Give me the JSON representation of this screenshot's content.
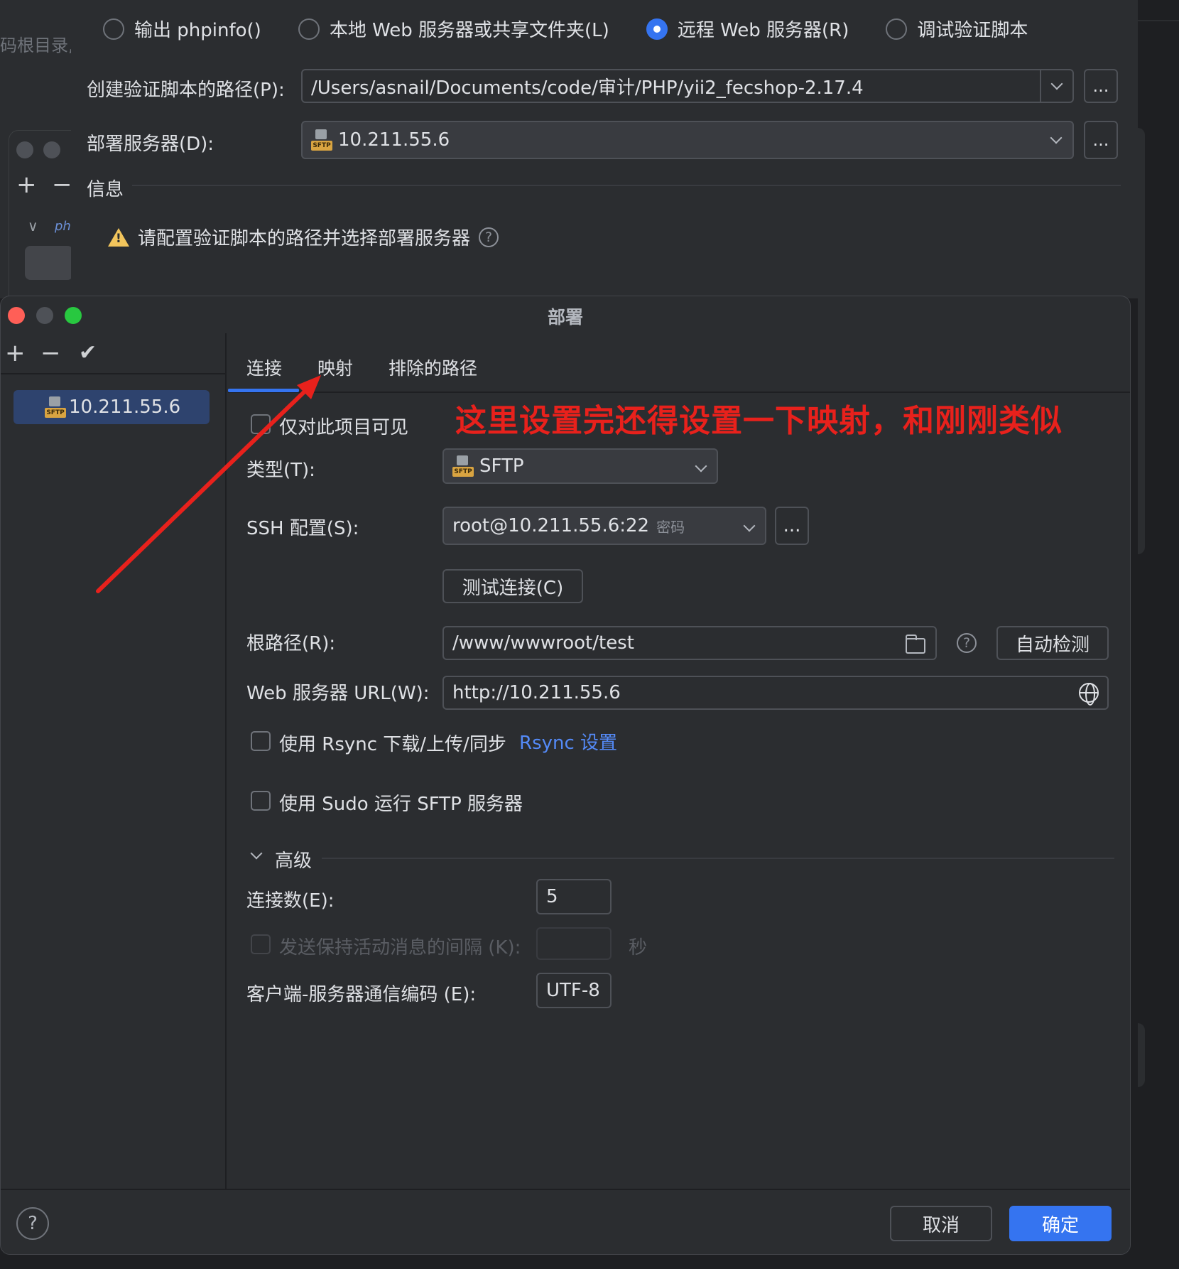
{
  "background_window": {
    "left_text": "码根目录,",
    "radio_options": [
      {
        "label": "输出 phpinfo()",
        "selected": false
      },
      {
        "label": "本地 Web 服务器或共享文件夹(L)",
        "selected": false
      },
      {
        "label": "远程 Web 服务器(R)",
        "selected": true
      },
      {
        "label": "调试验证脚本",
        "selected": false
      }
    ],
    "script_path_label": "创建验证脚本的路径(P):",
    "script_path_value": "/Users/asnail/Documents/code/审计/PHP/yii2_fecshop-2.17.4",
    "deploy_server_label": "部署服务器(D):",
    "deploy_server_value": "10.211.55.6",
    "info_heading": "信息",
    "warning_text": "请配置验证脚本的路径并选择部署服务器",
    "more_button": "...",
    "mini_php": "ph"
  },
  "dialog": {
    "title": "部署",
    "server_list": [
      "10.211.55.6"
    ],
    "tabs": [
      "连接",
      "映射",
      "排除的路径"
    ],
    "active_tab": "连接",
    "visible_only_label": "仅对此项目可见",
    "type_label": "类型(T):",
    "type_value": "SFTP",
    "ssh_label": "SSH 配置(S):",
    "ssh_value": "root@10.211.55.6:22",
    "ssh_hint": "密码",
    "more_button": "...",
    "test_connection": "测试连接(C)",
    "root_path_label": "根路径(R):",
    "root_path_value": "/www/wwwroot/test",
    "auto_detect": "自动检测",
    "web_url_label": "Web 服务器 URL(W):",
    "web_url_value": "http://10.211.55.6",
    "rsync_label": "使用 Rsync 下载/上传/同步",
    "rsync_link": "Rsync 设置",
    "sudo_label": "使用 Sudo 运行 SFTP 服务器",
    "advanced_heading": "高级",
    "connections_label": "连接数(E):",
    "connections_value": "5",
    "keepalive_label": "发送保持活动消息的间隔 (K):",
    "keepalive_value": "",
    "keepalive_unit": "秒",
    "encoding_label": "客户端-服务器通信编码 (E):",
    "encoding_value": "UTF-8",
    "cancel": "取消",
    "ok": "确定",
    "help": "?",
    "sftp_badge": "SFTP"
  },
  "annotation": {
    "text": "这里设置完还得设置一下映射，和刚刚类似",
    "color": "#e8211c"
  },
  "colors": {
    "accent": "#3574f0",
    "link": "#548af7",
    "warning": "#f2c55c",
    "background": "#2b2d30"
  }
}
